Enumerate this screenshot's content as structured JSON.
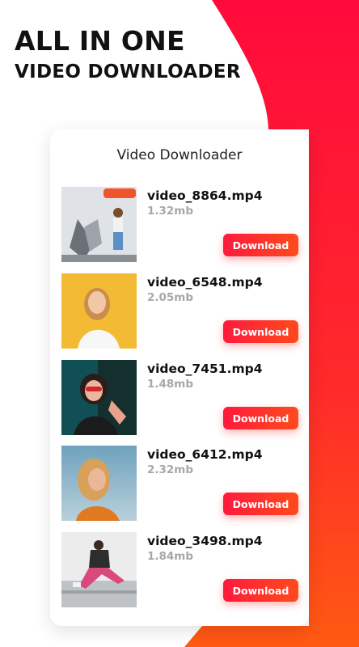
{
  "hero": {
    "line1": "ALL IN ONE",
    "line2": "VIDEO DOWNLOADER"
  },
  "card": {
    "title": "Video Downloader"
  },
  "items": [
    {
      "name": "video_8864.mp4",
      "size": "1.32mb",
      "button": "Download"
    },
    {
      "name": "video_6548.mp4",
      "size": "2.05mb",
      "button": "Download"
    },
    {
      "name": "video_7451.mp4",
      "size": "1.48mb",
      "button": "Download"
    },
    {
      "name": "video_6412.mp4",
      "size": "2.32mb",
      "button": "Download"
    },
    {
      "name": "video_3498.mp4",
      "size": "1.84mb",
      "button": "Download"
    }
  ],
  "colors": {
    "accent_start": "#ff1a3d",
    "accent_end": "#ff5a14",
    "size_text": "#a8a8a8"
  }
}
